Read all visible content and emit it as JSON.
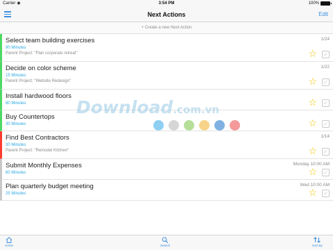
{
  "status_bar": {
    "carrier": "Carrier",
    "wifi_icon": "wifi-icon",
    "time": "3:54 PM",
    "battery_percent": "100%",
    "battery_level": 1.0
  },
  "nav": {
    "menu_icon": "hamburger-menu-icon",
    "title": "Next Actions",
    "edit_label": "Edit"
  },
  "create_row": {
    "label": "+ Create a new Next Action"
  },
  "tasks": [
    {
      "name": "Select team building exercises",
      "duration": "90 Minutes",
      "parent": "Parent Project: \"Plan corporate retreat\"",
      "meta": "1/24",
      "context_color": "#4cd964"
    },
    {
      "name": "Decide on color scheme",
      "duration": "15 Minutes",
      "parent": "Parent Project: \"Website Redesign\"",
      "meta": "1/22",
      "context_color": "#4cd964"
    },
    {
      "name": "Install hardwood floors",
      "duration": "80 Minutes",
      "parent": "",
      "meta": "",
      "context_color": "#4cd964"
    },
    {
      "name": "Buy Countertops",
      "duration": "30 Minutes",
      "parent": "",
      "meta": "",
      "context_color": "#4cd964"
    },
    {
      "name": "Find Best Contractors",
      "duration": "30 Minutes",
      "parent": "Parent Project: \"Remodel Kitchen\"",
      "meta": "1/14",
      "context_color": "#ff3b30"
    },
    {
      "name": "Submit Monthly Expenses",
      "duration": "60 Minutes",
      "parent": "",
      "meta": "Monday 10:00 AM",
      "context_color": "#c8c8c8"
    },
    {
      "name": "Plan quarterly budget meeting",
      "duration": "25 Minutes",
      "parent": "",
      "meta": "Wed 10:00 AM",
      "context_color": "#c8c8c8"
    }
  ],
  "watermark": {
    "brand": "Download",
    "suffix": ".com.vn",
    "dot_colors": [
      "#8fd0f2",
      "#d6d6d6",
      "#b6df99",
      "#f7d48a",
      "#7fb1e2",
      "#f59a9a"
    ]
  },
  "tab_bar": {
    "home_label": "Home",
    "search_label": "Search",
    "sort_label": "Sort By"
  },
  "colors": {
    "accent": "#3a8fe0",
    "duration": "#2aa9e0",
    "star": "#f2c200"
  }
}
